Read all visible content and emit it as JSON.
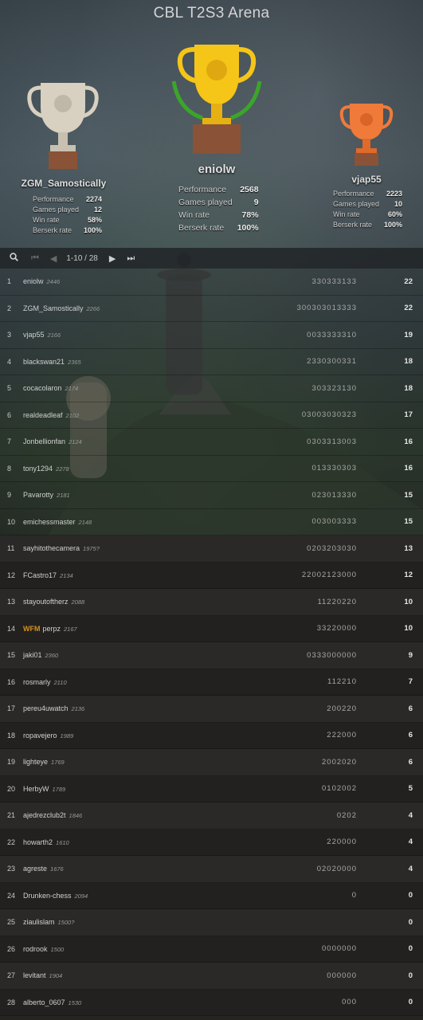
{
  "title": "CBL T2S3 Arena",
  "podium": [
    {
      "place": 2,
      "name": "ZGM_Samostically",
      "labels": [
        "Performance",
        "Games played",
        "Win rate",
        "Berserk rate"
      ],
      "values": [
        "2274",
        "12",
        "58%",
        "100%"
      ],
      "trophy_color": "#d8d0c0"
    },
    {
      "place": 1,
      "name": "eniolw",
      "labels": [
        "Performance",
        "Games played",
        "Win rate",
        "Berserk rate"
      ],
      "values": [
        "2568",
        "9",
        "78%",
        "100%"
      ],
      "trophy_color": "#f5c518"
    },
    {
      "place": 3,
      "name": "vjap55",
      "labels": [
        "Performance",
        "Games played",
        "Win rate",
        "Berserk rate"
      ],
      "values": [
        "2223",
        "10",
        "60%",
        "100%"
      ],
      "trophy_color": "#f07a3a"
    }
  ],
  "pager": {
    "range": "1-10 / 28"
  },
  "players": [
    {
      "rank": "1",
      "name": "eniolw",
      "rating": "2446",
      "sheet": "330333133",
      "score": "22"
    },
    {
      "rank": "2",
      "name": "ZGM_Samostically",
      "rating": "2266",
      "sheet": "300303013333",
      "score": "22"
    },
    {
      "rank": "3",
      "name": "vjap55",
      "rating": "2166",
      "sheet": "0033333310",
      "score": "19"
    },
    {
      "rank": "4",
      "name": "blackswan21",
      "rating": "2365",
      "sheet": "2330300331",
      "score": "18"
    },
    {
      "rank": "5",
      "name": "cocacolaron",
      "rating": "2174",
      "sheet": "303323130",
      "score": "18"
    },
    {
      "rank": "6",
      "name": "realdeadleaf",
      "rating": "2102",
      "sheet": "03003030323",
      "score": "17"
    },
    {
      "rank": "7",
      "name": "Jonbellionfan",
      "rating": "2124",
      "sheet": "0303313003",
      "score": "16"
    },
    {
      "rank": "8",
      "name": "tony1294",
      "rating": "2278",
      "sheet": "013330303",
      "score": "16"
    },
    {
      "rank": "9",
      "name": "Pavarotty",
      "rating": "2181",
      "sheet": "023013330",
      "score": "15"
    },
    {
      "rank": "10",
      "name": "emichessmaster",
      "rating": "2148",
      "sheet": "003003333",
      "score": "15"
    },
    {
      "rank": "11",
      "name": "sayhitothecamera",
      "rating": "1975?",
      "sheet": "0203203030",
      "score": "13"
    },
    {
      "rank": "12",
      "name": "FCastro17",
      "rating": "2134",
      "sheet": "22002123000",
      "score": "12"
    },
    {
      "rank": "13",
      "name": "stayoutoftherz",
      "rating": "2088",
      "sheet": "11220220",
      "score": "10"
    },
    {
      "rank": "14",
      "name": "perpz",
      "title": "WFM",
      "rating": "2167",
      "sheet": "33220000",
      "score": "10"
    },
    {
      "rank": "15",
      "name": "jaki01",
      "rating": "2360",
      "sheet": "0333000000",
      "score": "9"
    },
    {
      "rank": "16",
      "name": "rosmarly",
      "rating": "2110",
      "sheet": "112210",
      "score": "7"
    },
    {
      "rank": "17",
      "name": "pereu4uwatch",
      "rating": "2136",
      "sheet": "200220",
      "score": "6"
    },
    {
      "rank": "18",
      "name": "ropavejero",
      "rating": "1989",
      "sheet": "222000",
      "score": "6"
    },
    {
      "rank": "19",
      "name": "lighteye",
      "rating": "1769",
      "sheet": "2002020",
      "score": "6"
    },
    {
      "rank": "20",
      "name": "HerbyW",
      "rating": "1789",
      "sheet": "0102002",
      "score": "5"
    },
    {
      "rank": "21",
      "name": "ajedrezclub2t",
      "rating": "1846",
      "sheet": "0202",
      "score": "4"
    },
    {
      "rank": "22",
      "name": "howarth2",
      "rating": "1610",
      "sheet": "220000",
      "score": "4"
    },
    {
      "rank": "23",
      "name": "agreste",
      "rating": "1676",
      "sheet": "02020000",
      "score": "4"
    },
    {
      "rank": "24",
      "name": "Drunken-chess",
      "rating": "2094",
      "sheet": "0",
      "score": "0"
    },
    {
      "rank": "25",
      "name": "ziaulislam",
      "rating": "1500?",
      "sheet": "",
      "score": "0"
    },
    {
      "rank": "26",
      "name": "rodrook",
      "rating": "1500",
      "sheet": "0000000",
      "score": "0"
    },
    {
      "rank": "27",
      "name": "levitant",
      "rating": "1904",
      "sheet": "000000",
      "score": "0"
    },
    {
      "rank": "28",
      "name": "alberto_0607",
      "rating": "1530",
      "sheet": "000",
      "score": "0"
    }
  ],
  "icons": {
    "search": "search-icon",
    "first": "first-page-icon",
    "prev": "prev-page-icon",
    "next": "next-page-icon",
    "last": "last-page-icon"
  }
}
